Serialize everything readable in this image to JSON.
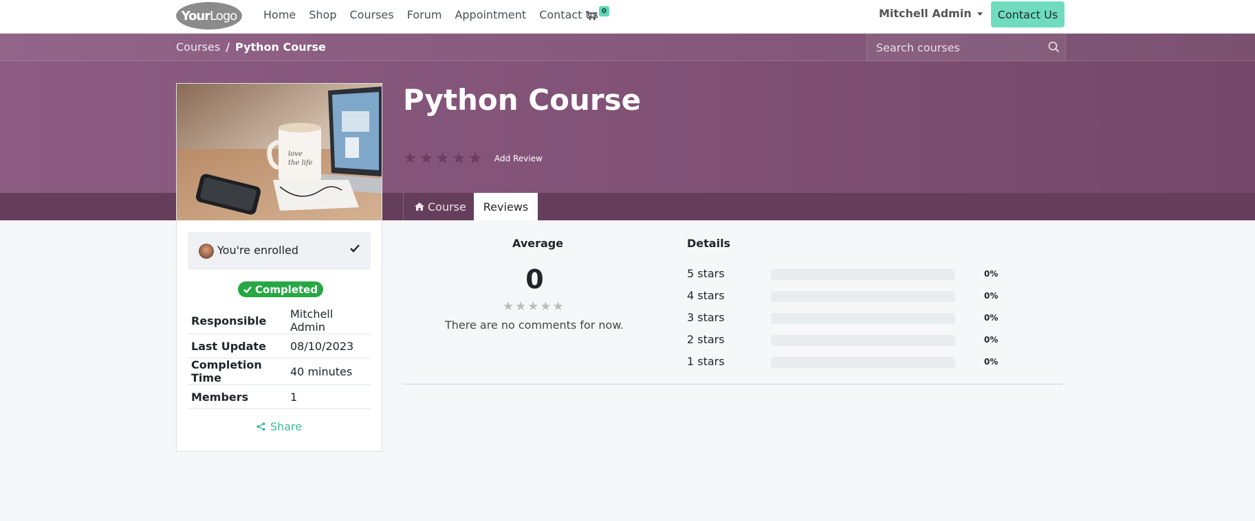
{
  "brand": {
    "logo_bold": "Your",
    "logo_rest": "Logo"
  },
  "nav": {
    "items": [
      {
        "label": "Home"
      },
      {
        "label": "Shop"
      },
      {
        "label": "Courses"
      },
      {
        "label": "Forum"
      },
      {
        "label": "Appointment"
      },
      {
        "label": "Contact us"
      }
    ],
    "cart_count": "0",
    "user": "Mitchell Admin",
    "contact_button": "Contact Us"
  },
  "breadcrumb": {
    "parent": "Courses",
    "separator": "/",
    "current": "Python Course"
  },
  "search": {
    "placeholder": "Search courses"
  },
  "course": {
    "title": "Python Course",
    "rating_stars": 0,
    "add_review": "Add Review",
    "image_alt": "coffee mug, phone and laptop on a table"
  },
  "tabs": [
    {
      "label": "Course",
      "icon": "home-icon",
      "active": false
    },
    {
      "label": "Reviews",
      "active": true
    }
  ],
  "sidebar": {
    "enrolled": "You're enrolled",
    "status": "Completed",
    "info": [
      {
        "key": "Responsible",
        "value": "Mitchell Admin"
      },
      {
        "key": "Last Update",
        "value": "08/10/2023"
      },
      {
        "key": "Completion Time",
        "value": "40 minutes"
      },
      {
        "key": "Members",
        "value": "1"
      }
    ],
    "share": "Share"
  },
  "reviews": {
    "average_title": "Average",
    "average_value": "0",
    "no_comments": "There are no comments for now.",
    "details_title": "Details",
    "rows": [
      {
        "label": "5 stars",
        "percent": "0%",
        "fraction": 0
      },
      {
        "label": "4 stars",
        "percent": "0%",
        "fraction": 0
      },
      {
        "label": "3 stars",
        "percent": "0%",
        "fraction": 0
      },
      {
        "label": "2 stars",
        "percent": "0%",
        "fraction": 0
      },
      {
        "label": "1 stars",
        "percent": "0%",
        "fraction": 0
      }
    ]
  },
  "colors": {
    "header_purple": "#7f5074",
    "tab_bar": "#643e5b",
    "accent_teal": "#6fdcbf",
    "success_green": "#28a745"
  }
}
